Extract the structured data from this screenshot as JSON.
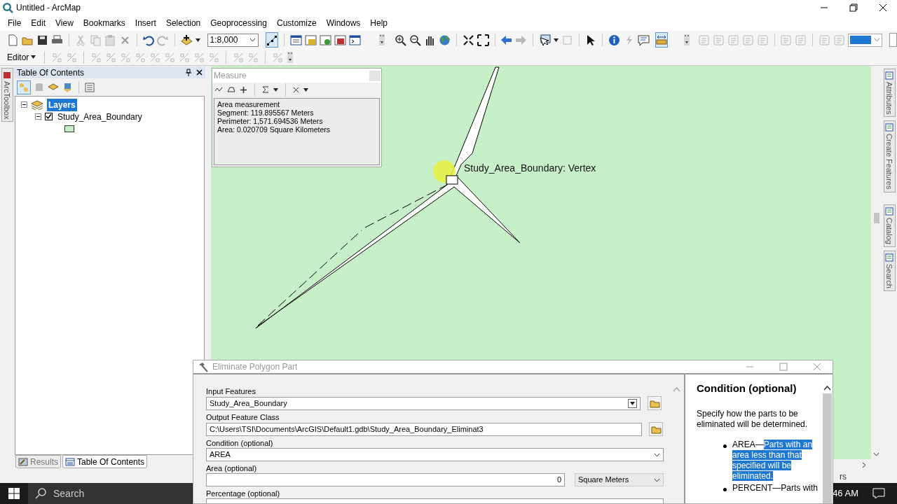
{
  "window": {
    "title": "Untitled - ArcMap"
  },
  "menu": [
    "File",
    "Edit",
    "View",
    "Bookmarks",
    "Insert",
    "Selection",
    "Geoprocessing",
    "Customize",
    "Windows",
    "Help"
  ],
  "toolbar": {
    "scale": "1:8,000",
    "editor": "Editor"
  },
  "left_tabs": [
    "ArcToolbox"
  ],
  "toc": {
    "title": "Table Of Contents",
    "tree": [
      {
        "label": "Layers",
        "selected": true,
        "expanded": true,
        "children": [
          {
            "label": "Study_Area_Boundary",
            "checked": true,
            "expanded": true,
            "color": "#c8f0c8"
          }
        ]
      }
    ],
    "tabs": [
      {
        "label": "Results",
        "selected": false
      },
      {
        "label": "Table Of Contents",
        "selected": true
      }
    ]
  },
  "measure": {
    "title": "Measure",
    "lines": [
      "Area measurement",
      "Segment: 119.895567 Meters",
      "Perimeter: 1,571.694536 Meters",
      "Area: 0.020709 Square Kilometers"
    ]
  },
  "map": {
    "vertex_label": "Study_Area_Boundary: Vertex"
  },
  "right_tabs": [
    "Attributes",
    "Create Features",
    "Catalog",
    "Search"
  ],
  "status_text": "rs",
  "dialog": {
    "title": "Eliminate Polygon Part",
    "fields": [
      {
        "label": "Input Features",
        "kind": "dropdown",
        "value": "Study_Area_Boundary",
        "browse": true
      },
      {
        "label": "Output Feature Class",
        "kind": "text",
        "value": "C:\\Users\\TSI\\Documents\\ArcGIS\\Default1.gdb\\Study_Area_Boundary_Eliminat3",
        "browse": true
      },
      {
        "label": "Condition (optional)",
        "kind": "select",
        "value": "AREA",
        "browse": false
      },
      {
        "label": "Area (optional)",
        "kind": "number",
        "value": "0",
        "unit": "Square Meters",
        "browse": false
      },
      {
        "label": "Percentage (optional)",
        "kind": "text",
        "browse": false
      }
    ],
    "help": {
      "heading": "Condition (optional)",
      "description": "Specify how the parts to be eliminated will be determined.",
      "bullets": [
        {
          "term": "AREA—",
          "text": "Parts with an area less than that specified will be eliminated.",
          "selected": true
        },
        {
          "term": "PERCENT—",
          "text": "Parts with",
          "selected": false
        }
      ]
    }
  },
  "taskbar": {
    "search": "Search",
    "clock": "46 AM"
  }
}
